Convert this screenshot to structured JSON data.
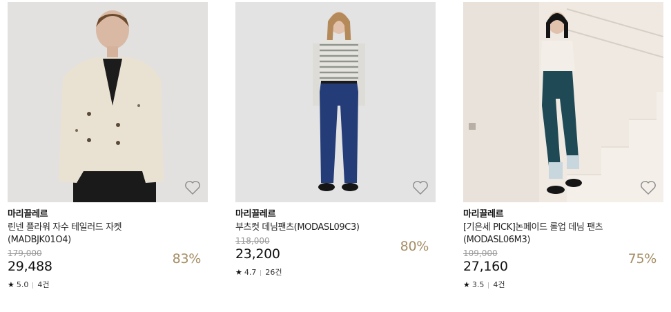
{
  "products": [
    {
      "brand": "마리끌레르",
      "name_line1": "린넨 플라워 자수 테일러드 자켓",
      "name_line2": "(MADBJK01O4)",
      "original_price": "179,000",
      "price": "29,488",
      "discount": "83%",
      "rating": "5.0",
      "reviews": "4건",
      "wishlist_icon": "heart-outline-icon"
    },
    {
      "brand": "마리끌레르",
      "name_line1": "부츠컷 데님팬츠(MODASL09C3)",
      "name_line2": "",
      "original_price": "118,000",
      "price": "23,200",
      "discount": "80%",
      "rating": "4.7",
      "reviews": "26건",
      "wishlist_icon": "heart-outline-icon"
    },
    {
      "brand": "마리끌레르",
      "name_line1": "[기은세 PICK]논페이드 롤업 데님 팬츠",
      "name_line2": "(MODASL06M3)",
      "original_price": "109,000",
      "price": "27,160",
      "discount": "75%",
      "rating": "3.5",
      "reviews": "4건",
      "wishlist_icon": "heart-outline-icon"
    }
  ],
  "colors": {
    "discount": "#a58d63",
    "strikethrough": "#9a9a9a"
  }
}
